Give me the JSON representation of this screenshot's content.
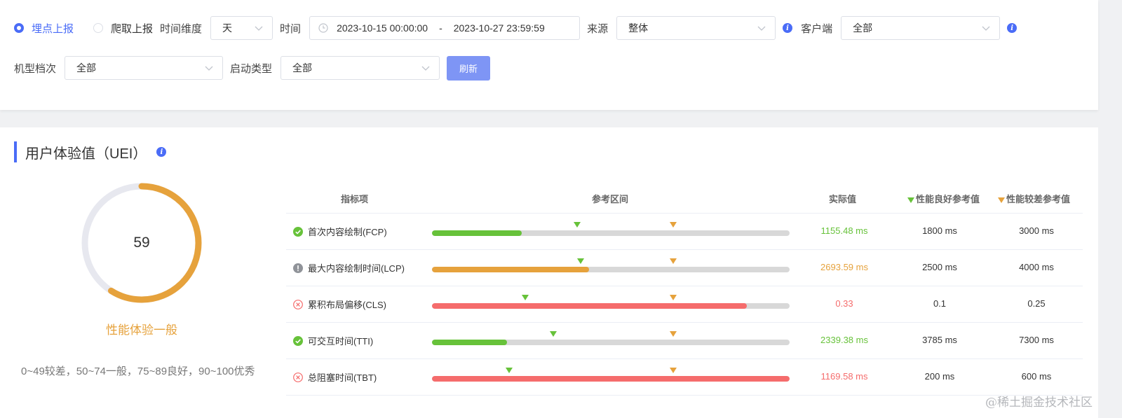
{
  "filters": {
    "radio_options": [
      {
        "label": "埋点上报",
        "checked": true
      },
      {
        "label": "爬取上报",
        "checked": false
      }
    ],
    "time_dimension": {
      "label": "时间维度",
      "value": "天"
    },
    "time_range": {
      "label": "时间",
      "start": "2023-10-15 00:00:00",
      "separator": "-",
      "end": "2023-10-27 23:59:59"
    },
    "source": {
      "label": "来源",
      "value": "整体"
    },
    "client": {
      "label": "客户端",
      "value": "全部"
    },
    "device_tier": {
      "label": "机型档次",
      "value": "全部"
    },
    "launch_type": {
      "label": "启动类型",
      "value": "全部"
    },
    "refresh_label": "刷新"
  },
  "uei": {
    "title": "用户体验值（UEI）",
    "score": "59",
    "score_fraction": 0.59,
    "status": "性能体验一般",
    "legend": "0~49较差，50~74一般，75~89良好，90~100优秀",
    "colors": {
      "good": "#67c23a",
      "warn": "#e6a23c",
      "bad": "#f56c6c",
      "accent": "#4a6cf7"
    },
    "headers": {
      "metric": "指标项",
      "range": "参考区间",
      "actual": "实际值",
      "good_ref": "性能良好参考值",
      "bad_ref": "性能较差参考值"
    },
    "metrics": [
      {
        "name": "首次内容绘制(FCP)",
        "status": "good",
        "icon": "check-circle-icon",
        "fill": 0.25,
        "good_pos": 0.405,
        "bad_pos": 0.675,
        "actual": "1155.48 ms",
        "good_ref": "1800 ms",
        "bad_ref": "3000 ms"
      },
      {
        "name": "最大内容绘制时间(LCP)",
        "status": "warn",
        "icon": "exclamation-circle-icon",
        "fill": 0.44,
        "good_pos": 0.415,
        "bad_pos": 0.675,
        "actual": "2693.59 ms",
        "good_ref": "2500 ms",
        "bad_ref": "4000 ms"
      },
      {
        "name": "累积布局偏移(CLS)",
        "status": "bad",
        "icon": "x-circle-icon",
        "fill": 0.88,
        "good_pos": 0.26,
        "bad_pos": 0.675,
        "actual": "0.33",
        "good_ref": "0.1",
        "bad_ref": "0.25"
      },
      {
        "name": "可交互时间(TTI)",
        "status": "good",
        "icon": "check-circle-icon",
        "fill": 0.21,
        "good_pos": 0.34,
        "bad_pos": 0.675,
        "actual": "2339.38 ms",
        "good_ref": "3785 ms",
        "bad_ref": "7300 ms"
      },
      {
        "name": "总阻塞时间(TBT)",
        "status": "bad",
        "icon": "x-circle-icon",
        "fill": 1.0,
        "good_pos": 0.215,
        "bad_pos": 0.675,
        "actual": "1169.58 ms",
        "good_ref": "200 ms",
        "bad_ref": "600 ms"
      }
    ]
  },
  "watermark": "@稀土掘金技术社区"
}
